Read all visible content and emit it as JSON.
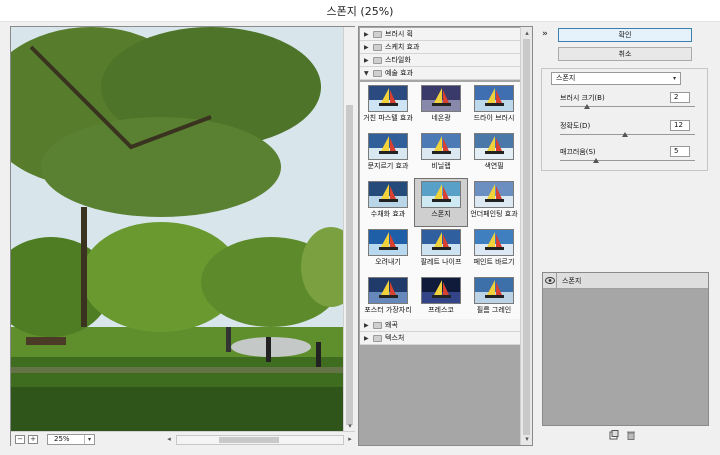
{
  "window": {
    "title": "스폰지 (25%)"
  },
  "preview": {
    "zoom_value": "25%",
    "zoom_out": "−",
    "zoom_in": "+"
  },
  "gallery": {
    "categories_top": [
      {
        "label": "브러시 획",
        "expanded": false
      },
      {
        "label": "스케치 효과",
        "expanded": false
      },
      {
        "label": "스타일화",
        "expanded": false
      },
      {
        "label": "예술 효과",
        "expanded": true
      }
    ],
    "filters": [
      "거친 파스텔 효과",
      "네온광",
      "드라이 브러시",
      "문지르기 효과",
      "비닐랩",
      "색연필",
      "수채화 효과",
      "스폰지",
      "언더페인팅 효과",
      "오려내기",
      "팔레트 나이프",
      "페인트 바르기",
      "포스터 가장자리",
      "프레스코",
      "필름 그레인"
    ],
    "selected_filter": "스폰지",
    "categories_bottom": [
      {
        "label": "왜곡",
        "expanded": false
      },
      {
        "label": "텍스처",
        "expanded": false
      }
    ]
  },
  "actions": {
    "ok_label": "확인",
    "cancel_label": "취소",
    "collapse": "»"
  },
  "settings": {
    "filter_select": "스폰지",
    "params": [
      {
        "label": "브러시 크기(B)",
        "value": "2",
        "fraction": 0.2
      },
      {
        "label": "정확도(D)",
        "value": "12",
        "fraction": 0.48
      },
      {
        "label": "매끄러움(S)",
        "value": "5",
        "fraction": 0.27
      }
    ]
  },
  "layers": {
    "items": [
      {
        "label": "스폰지",
        "visible": true
      }
    ]
  },
  "colors": {
    "accent": "#3c7fb1",
    "panel_gray": "#a6a6a6",
    "selected_cell": "#cfcfcf"
  }
}
